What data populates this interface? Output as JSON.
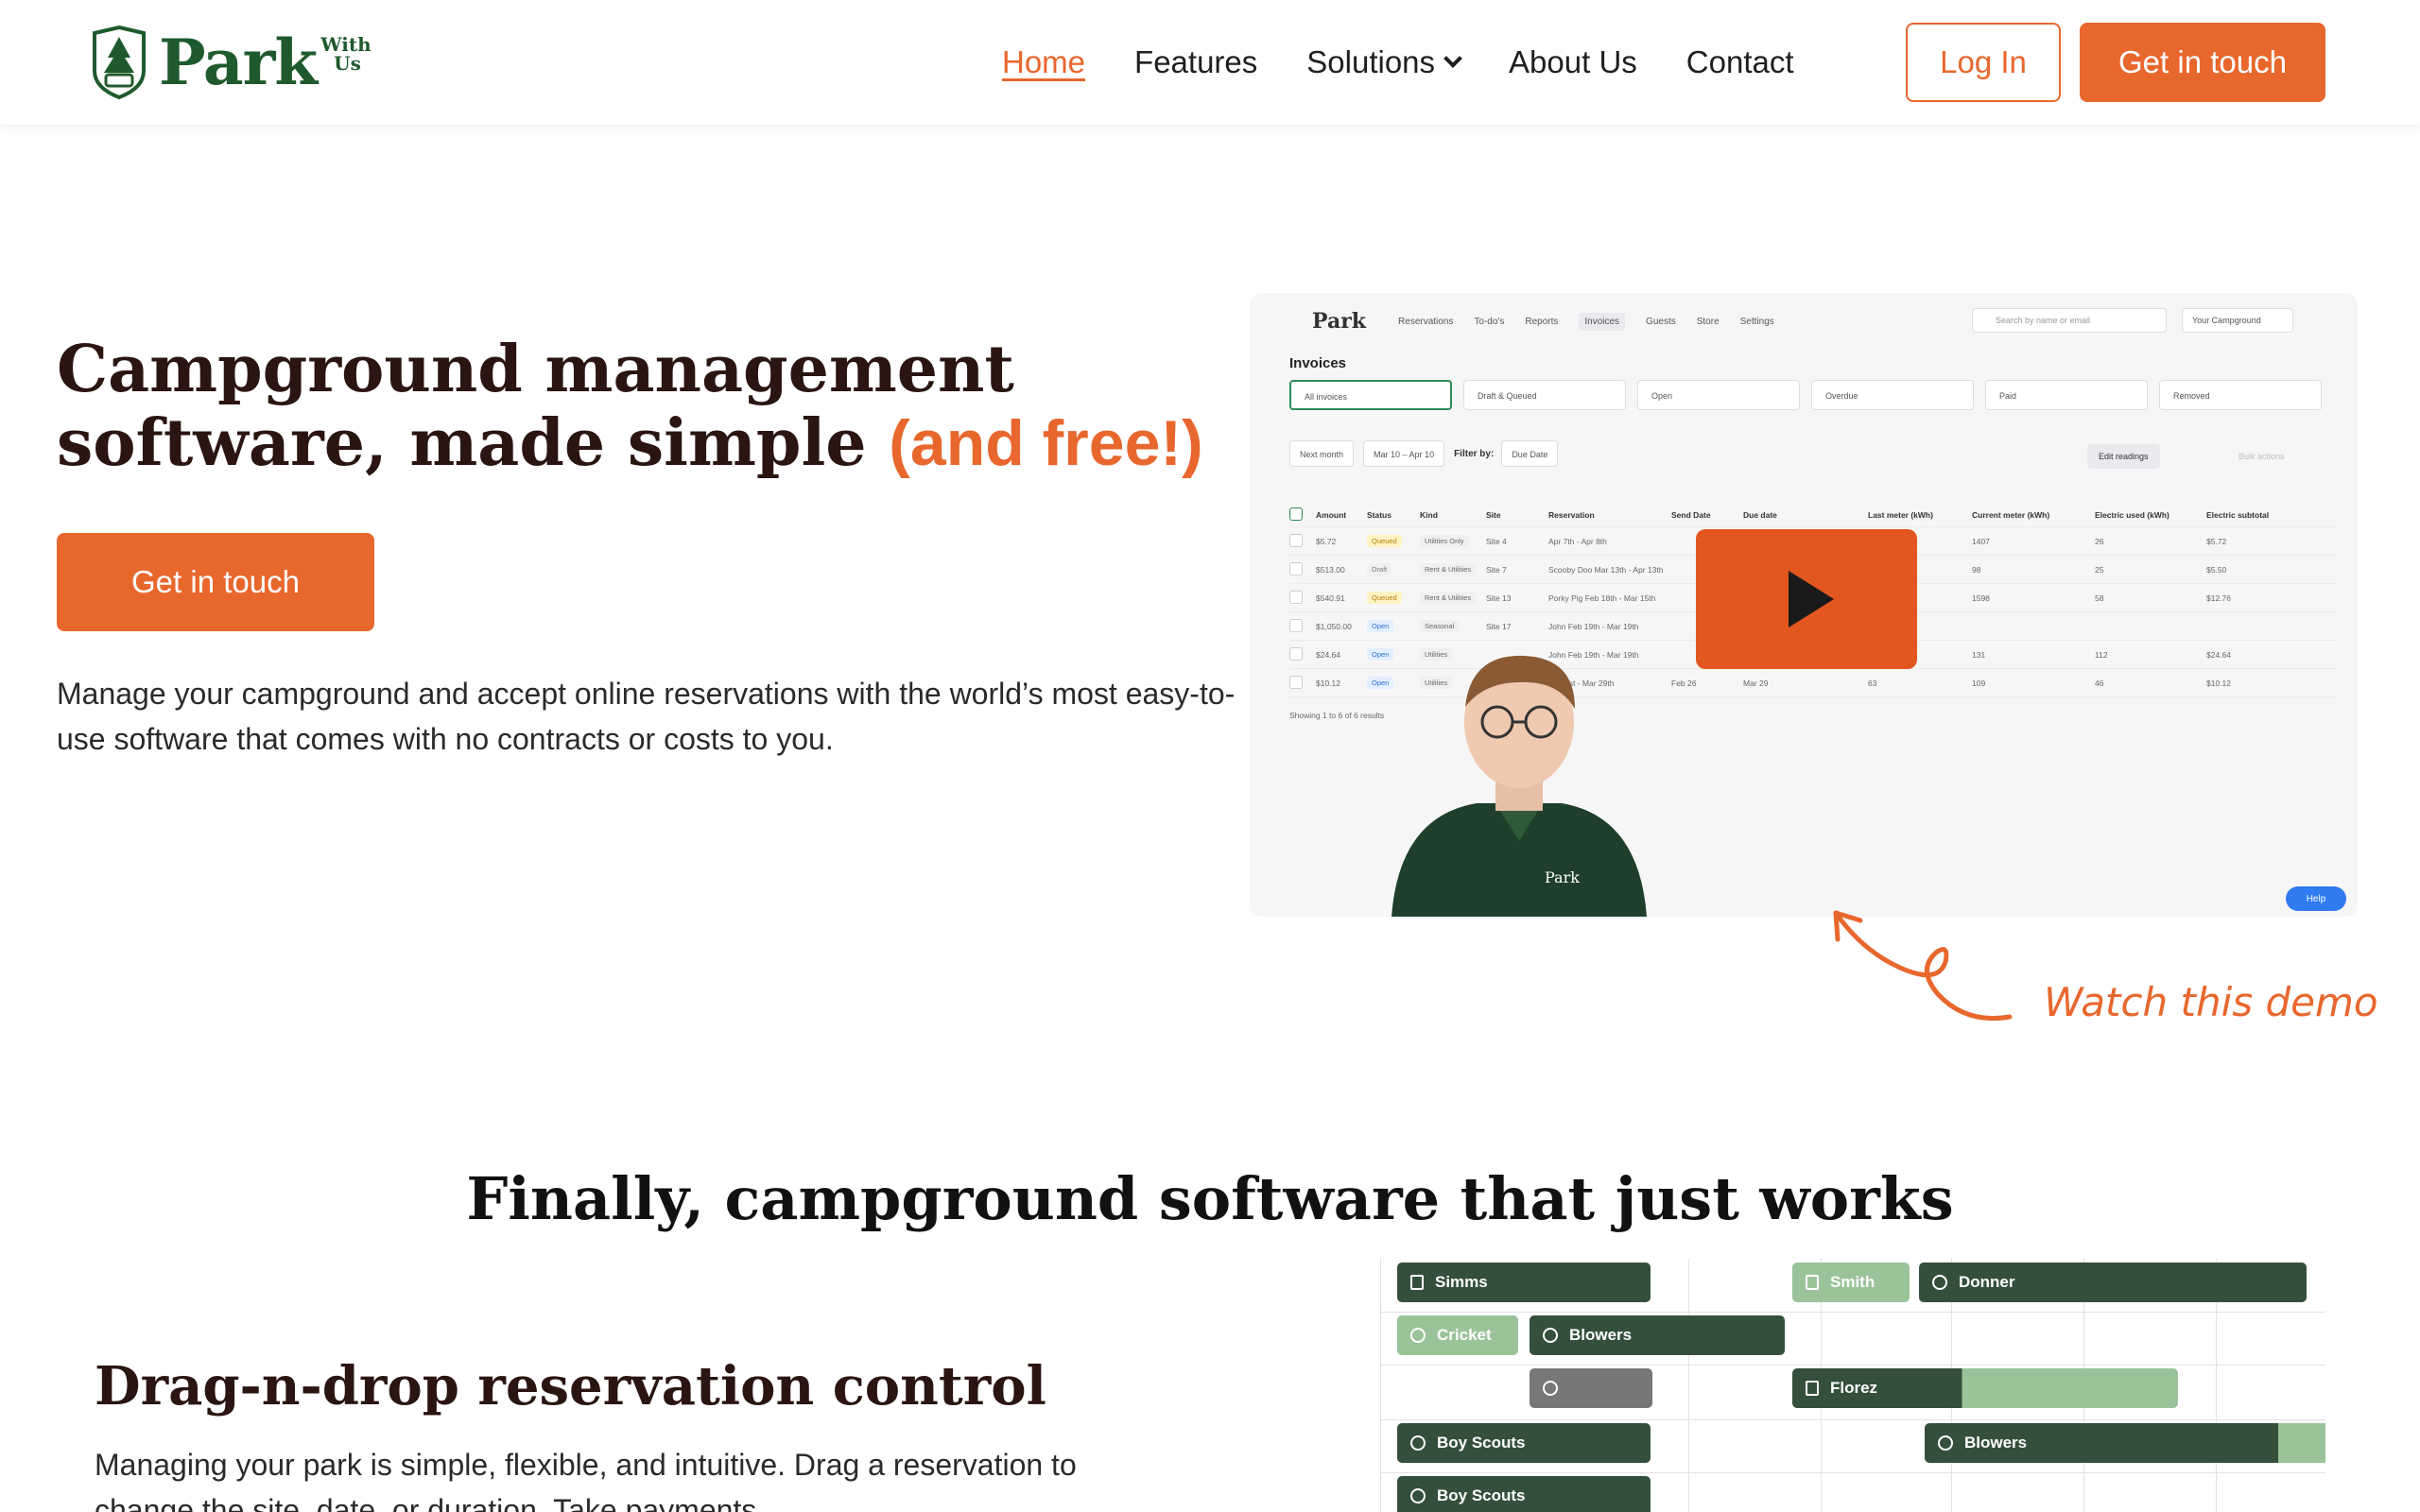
{
  "brand": {
    "name": "Park",
    "with": "With",
    "us": "Us",
    "green": "#1f5a2e",
    "accent": "#e8672d"
  },
  "nav": {
    "links": [
      {
        "label": "Home",
        "active": true
      },
      {
        "label": "Features"
      },
      {
        "label": "Solutions"
      },
      {
        "label": "About Us"
      },
      {
        "label": "Contact"
      }
    ],
    "login": "Log In",
    "cta": "Get in touch"
  },
  "hero": {
    "title_main": "Campground management software, made simple",
    "title_accent": "(and free!)",
    "cta": "Get in touch",
    "description": "Manage your campground and accept online reservations with the world’s most easy-to-use software that comes with no contracts or costs to you."
  },
  "video": {
    "app_logo": "Park",
    "tabs": [
      "Reservations",
      "To-do's",
      "Reports",
      "Invoices",
      "Guests",
      "Store",
      "Settings"
    ],
    "search_placeholder": "Search by name or email",
    "campground_select": "Your Campground",
    "invoices_title": "Invoices",
    "filters": [
      "All invoices",
      "Draft & Queued",
      "Open",
      "Overdue",
      "Paid",
      "Removed"
    ],
    "tool_month": "Next month",
    "tool_range": "Mar 10 – Apr 10",
    "filter_by": "Filter by:",
    "filter_due": "Due Date",
    "edit_readings": "Edit readings",
    "bulk_actions": "Bulk actions",
    "columns": [
      "Amount",
      "Status",
      "Kind",
      "Site",
      "Reservation",
      "Send Date",
      "Due date",
      "Last meter (kWh)",
      "Current meter (kWh)",
      "Electric used (kWh)",
      "Electric subtotal"
    ],
    "rows": [
      {
        "amount": "$5.72",
        "status": "Queued",
        "kind": "Utilities Only",
        "site": "Site 4",
        "res": "Apr 7th - Apr 8th",
        "send": "",
        "due": "",
        "last": "",
        "current": "1407",
        "used": "26",
        "subtotal": "$5.72"
      },
      {
        "amount": "$513.00",
        "status": "Draft",
        "kind": "Rent & Utilities",
        "site": "Site 7",
        "res": "Scooby Doo Mar 13th - Apr 13th",
        "send": "",
        "due": "",
        "last": "",
        "current": "98",
        "used": "25",
        "subtotal": "$5.50"
      },
      {
        "amount": "$540.91",
        "status": "Queued",
        "kind": "Rent & Utilities",
        "site": "Site 13",
        "res": "Porky Pig Feb 18th - Mar 15th",
        "send": "",
        "due": "",
        "last": "",
        "current": "1598",
        "used": "58",
        "subtotal": "$12.76"
      },
      {
        "amount": "$1,050.00",
        "status": "Open",
        "kind": "Seasonal",
        "site": "Site 17",
        "res": "John Feb 19th - Mar 19th",
        "send": "",
        "due": "",
        "last": "",
        "current": "",
        "used": "",
        "subtotal": ""
      },
      {
        "amount": "$24.64",
        "status": "Open",
        "kind": "Utilities",
        "site": "",
        "res": "John Feb 19th - Mar 19th",
        "send": "",
        "due": "",
        "last": "",
        "current": "131",
        "used": "112",
        "subtotal": "$24.64"
      },
      {
        "amount": "$10.12",
        "status": "Open",
        "kind": "Utilities",
        "site": "",
        "res": "Mar 1st - Mar 29th",
        "send": "Feb 26",
        "due": "Mar 29",
        "last": "63",
        "current": "109",
        "used": "46",
        "subtotal": "$10.12"
      }
    ],
    "showing": "Showing 1 to 6 of 6 results",
    "help": "Help",
    "shirt_logo": "Park"
  },
  "watch_demo": "Watch this demo",
  "section2": {
    "title": "Finally, campground software that just works",
    "feature_title": "Drag-n-drop reservation control",
    "feature_desc": "Managing your park is simple, flexible, and intuitive. Drag a reservation to change the site, date, or duration. Take payments"
  },
  "gantt": {
    "bars": [
      "Simms",
      "Smith",
      "Donner",
      "Cricket",
      "Blowers",
      "",
      "Florez",
      "Boy Scouts",
      "Blowers",
      "Boy Scouts"
    ]
  }
}
